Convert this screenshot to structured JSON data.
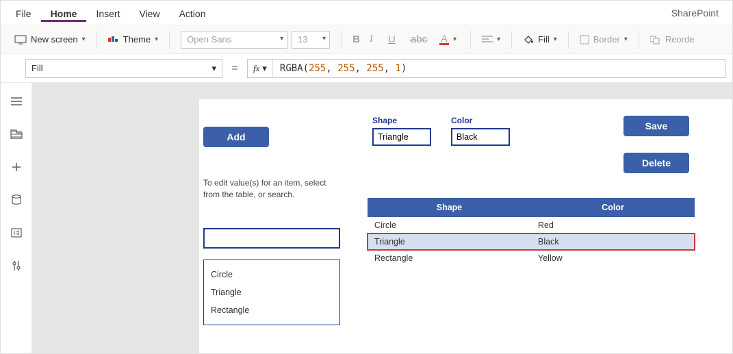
{
  "brand": "SharePoint",
  "menubar": {
    "tabs": [
      "File",
      "Home",
      "Insert",
      "View",
      "Action"
    ],
    "active": 1
  },
  "ribbon": {
    "newScreen": "New screen",
    "theme": "Theme",
    "font": "Open Sans",
    "fontSize": "13",
    "fill": "Fill",
    "border": "Border",
    "reorder": "Reorde"
  },
  "formula": {
    "property": "Fill",
    "fx": "fx",
    "fn": "RGBA",
    "args": [
      "255",
      "255",
      "255",
      "1"
    ]
  },
  "canvasApp": {
    "buttons": {
      "add": "Add",
      "save": "Save",
      "delete": "Delete"
    },
    "fields": {
      "shapeLabel": "Shape",
      "shapeValue": "Triangle",
      "colorLabel": "Color",
      "colorValue": "Black"
    },
    "hint1": "To edit value(s) for an item, select",
    "hint2": "from the table, or search.",
    "list": [
      "Circle",
      "Triangle",
      "Rectangle"
    ],
    "table": {
      "headers": [
        "Shape",
        "Color"
      ],
      "rows": [
        {
          "shape": "Circle",
          "color": "Red",
          "selected": false
        },
        {
          "shape": "Triangle",
          "color": "Black",
          "selected": true
        },
        {
          "shape": "Rectangle",
          "color": "Yellow",
          "selected": false
        }
      ]
    }
  }
}
